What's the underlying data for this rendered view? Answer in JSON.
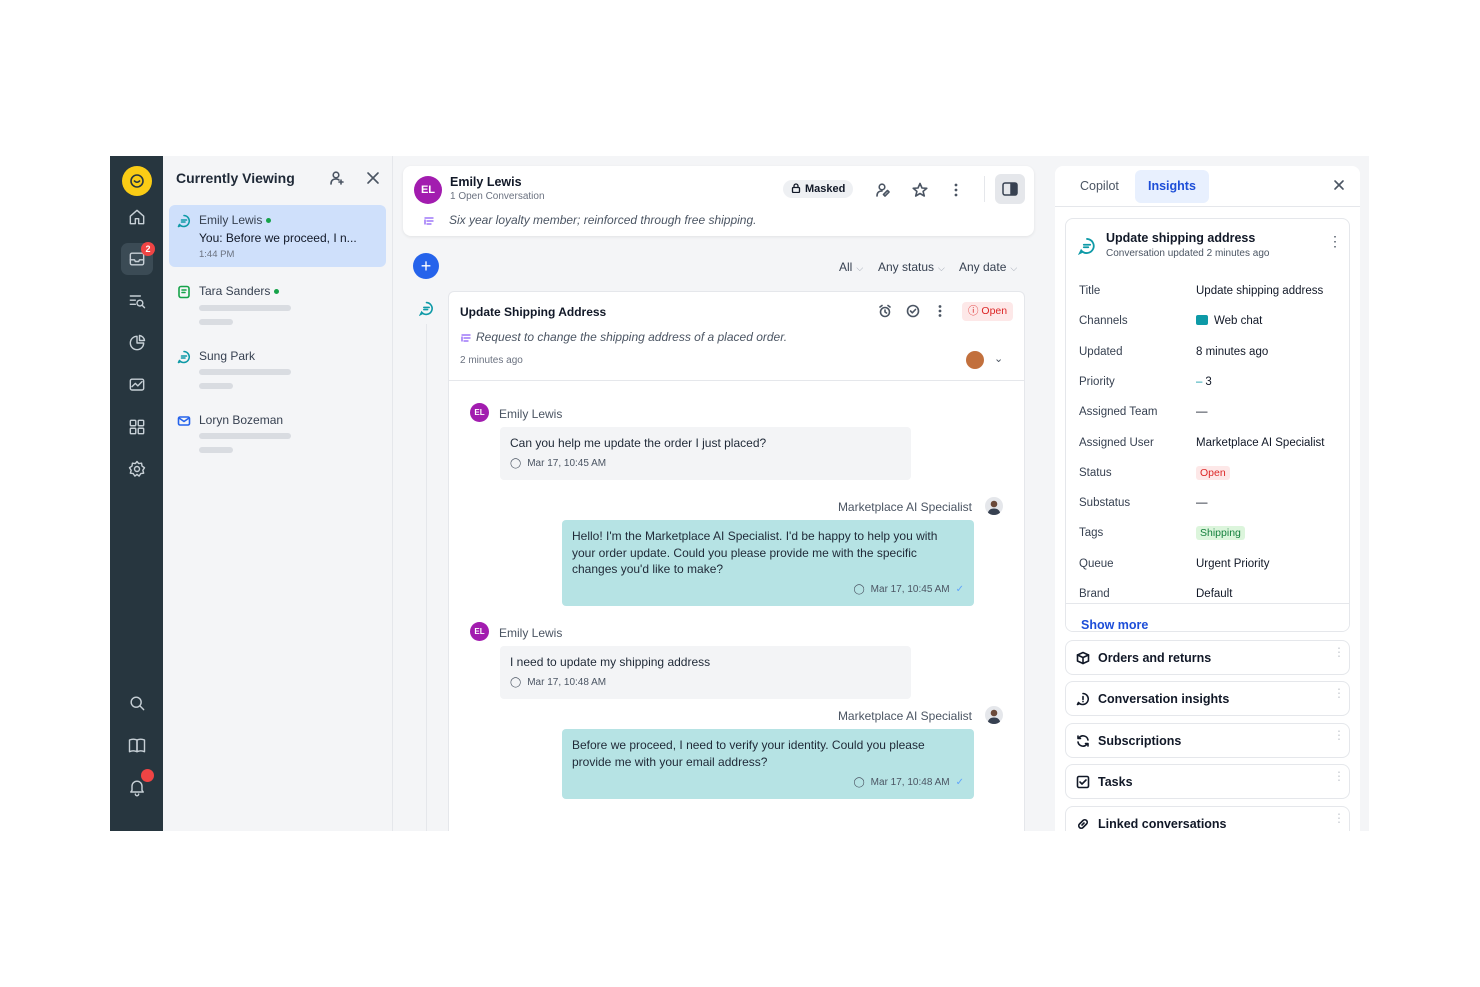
{
  "rail": {
    "items": [
      "home-icon",
      "inbox-icon",
      "search-list-icon",
      "reports-icon",
      "monitor-icon",
      "apps-icon",
      "settings-icon"
    ],
    "inbox_badge": "2",
    "bottom": [
      "search-icon",
      "knowledge-icon",
      "bell-icon"
    ]
  },
  "viewing": {
    "title": "Currently Viewing",
    "items": [
      {
        "name": "Emily Lewis",
        "message": "You: Before we proceed, I n...",
        "time": "1:44 PM",
        "channel": "chat"
      },
      {
        "name": "Tara Sanders",
        "channel": "phone"
      },
      {
        "name": "Sung Park",
        "channel": "chat"
      },
      {
        "name": "Loryn Bozeman",
        "channel": "email"
      }
    ]
  },
  "header": {
    "initials": "EL",
    "name": "Emily Lewis",
    "subtitle": "1 Open Conversation",
    "note": "Six year loyalty member; reinforced through free shipping.",
    "masked_label": "Masked"
  },
  "filters": {
    "all": "All",
    "status": "Any status",
    "date": "Any date"
  },
  "conversation": {
    "title": "Update Shipping Address",
    "description": "Request to change the shipping address of a placed order.",
    "time": "2 minutes ago",
    "status": "Open",
    "messages": [
      {
        "author": "Emily Lewis",
        "initials": "EL",
        "text": "Can you help me update the order I just placed?",
        "time": "Mar 17, 10:45 AM"
      },
      {
        "author": "Marketplace AI Specialist",
        "text": "Hello! I'm the Marketplace AI Specialist. I'd be happy to help you with your order update. Could you please provide me with the specific changes you'd like to make?",
        "time": "Mar 17, 10:45 AM"
      },
      {
        "author": "Emily Lewis",
        "initials": "EL",
        "text": "I need to update my shipping address",
        "time": "Mar 17, 10:48 AM"
      },
      {
        "author": "Marketplace AI Specialist",
        "text": "Before we proceed, I need to verify your identity. Could you please provide me with your email address?",
        "time": "Mar 17, 10:48 AM"
      }
    ]
  },
  "right": {
    "tabs": [
      "Copilot",
      "Insights"
    ],
    "active_tab": "Insights",
    "card_title": "Update shipping address",
    "card_subtitle": "Conversation updated 2 minutes ago",
    "fields": [
      {
        "k": "Title",
        "v": "Update shipping address"
      },
      {
        "k": "Channels",
        "v": "Web chat"
      },
      {
        "k": "Updated",
        "v": "8 minutes ago"
      },
      {
        "k": "Priority",
        "v": "3"
      },
      {
        "k": "Assigned Team",
        "v": "—"
      },
      {
        "k": "Assigned User",
        "v": "Marketplace AI Specialist"
      },
      {
        "k": "Status",
        "v": "Open"
      },
      {
        "k": "Substatus",
        "v": "—"
      },
      {
        "k": "Tags",
        "v": "Shipping"
      },
      {
        "k": "Queue",
        "v": "Urgent Priority"
      },
      {
        "k": "Brand",
        "v": "Default"
      }
    ],
    "show_more": "Show more",
    "sections": [
      "Orders and returns",
      "Conversation insights",
      "Subscriptions",
      "Tasks",
      "Linked conversations"
    ]
  },
  "colors": {
    "rail": "#27363f",
    "accent": "#1d4ed8",
    "agent_bubble": "#b6e3e4",
    "open": "#dc2626"
  }
}
